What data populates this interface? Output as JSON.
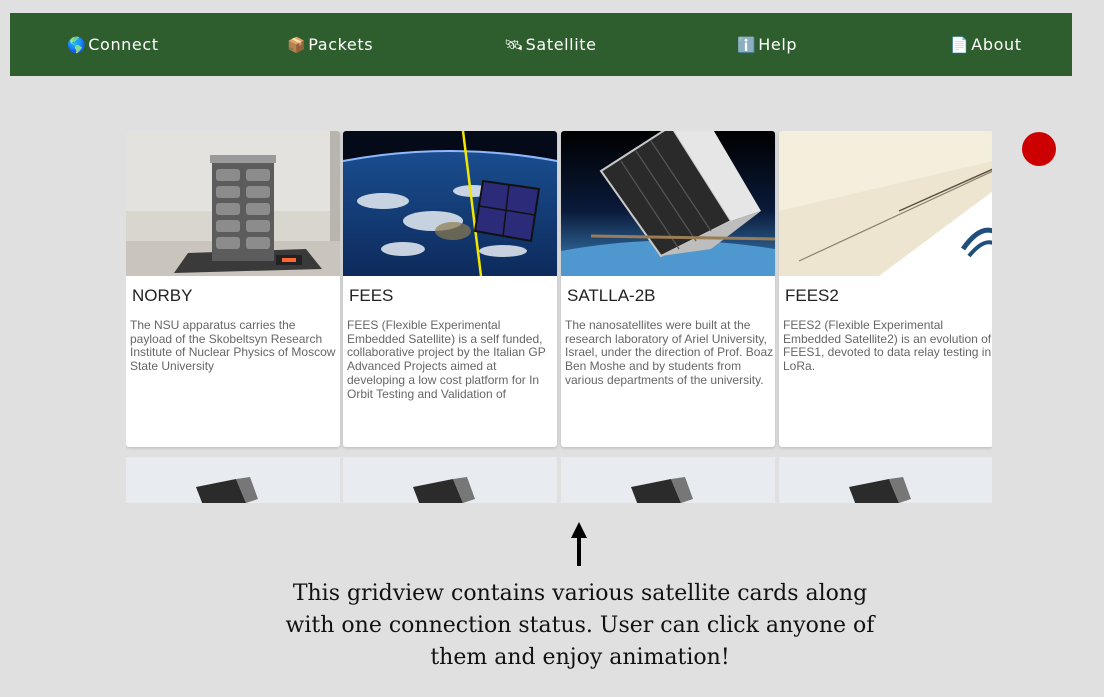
{
  "nav": {
    "connect": {
      "icon": "🌎",
      "label": "Connect"
    },
    "packets": {
      "icon": "📦",
      "label": "Packets"
    },
    "satellite": {
      "icon": "🛰",
      "label": "Satellite"
    },
    "help": {
      "icon": "ℹ️",
      "label": "Help"
    },
    "about": {
      "icon": "📄",
      "label": "About"
    }
  },
  "connection_status": {
    "state": "disconnected",
    "color": "#cc0000"
  },
  "cards": [
    {
      "title": "NORBY",
      "description": "The NSU apparatus carries the payload of the Skobeltsyn Research Institute of Nuclear Physics of Moscow State University"
    },
    {
      "title": "FEES",
      "description": "FEES (Flexible Experimental Embedded Satellite) is a self funded, collaborative project by the Italian GP Advanced Projects aimed at developing a low cost platform for In Orbit Testing and Validation of"
    },
    {
      "title": "SATLLA-2B",
      "description": "The nanosatellites were built at the research laboratory of Ariel University, Israel, under the direction of Prof. Boaz Ben Moshe and by students from various departments of the university."
    },
    {
      "title": "FEES2",
      "description": "FEES2 (Flexible Experimental Embedded Satellite2) is an evolution of FEES1, devoted to data relay testing in LoRa."
    }
  ],
  "caption": "This gridview contains various satellite cards along with one connection status. User can click anyone of them and enjoy animation!",
  "colors": {
    "navbar": "#2f5e2e",
    "background": "#e0e0e0",
    "status": "#cc0000"
  }
}
